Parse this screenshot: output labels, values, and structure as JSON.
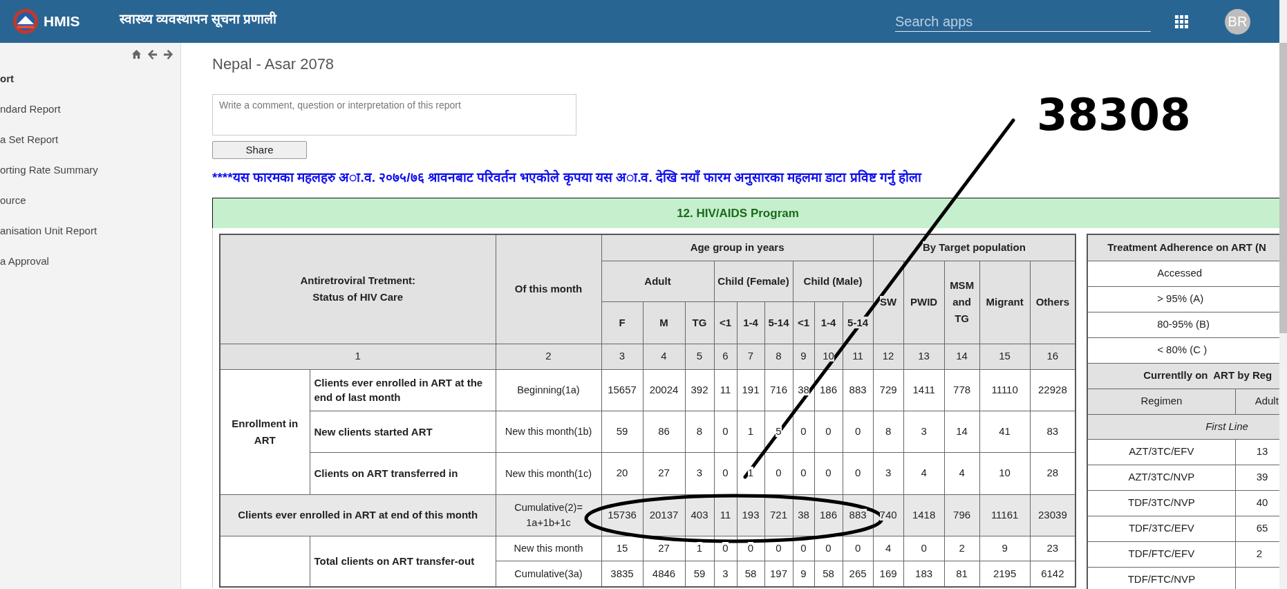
{
  "header": {
    "logo_text": "HMIS",
    "app_title": "स्वास्थ्य व्यवस्थापन सूचना प्रणाली",
    "search": {
      "placeholder": "Search apps"
    },
    "avatar": "BR"
  },
  "sidebar": {
    "items": [
      {
        "label": "ort",
        "kind": "heading"
      },
      {
        "label": "ndard Report",
        "kind": "link"
      },
      {
        "label": "a Set Report",
        "kind": "link"
      },
      {
        "label": "orting Rate Summary",
        "kind": "link"
      },
      {
        "label": "ource",
        "kind": "link"
      },
      {
        "label": "anisation Unit Report",
        "kind": "link"
      },
      {
        "label": "a Approval",
        "kind": "link"
      }
    ]
  },
  "page_title": "Nepal - Asar 2078",
  "comment": {
    "placeholder": "Write a comment, question or interpretation of this report"
  },
  "share_button": "Share",
  "notice": "****यस फारमका महलहरु अ◌ा.व. २०७५/७६ श्रावनबाट परिवर्तन भएकोले कृपया यस अ◌ा.व. देखि नयाँ फारम अनुसारका महलमा डाटा प्रविष्ट गर्नु होला",
  "section_title": "12. HIV/AIDS Program",
  "art_table": {
    "header_rows": [
      {
        "kind": "heading",
        "cells": [
          {
            "text": "Antiretroviral Tretment:\nStatus of HIV Care",
            "colspan": 2,
            "rowspan": 3
          },
          {
            "text": "Of this month",
            "rowspan": 3
          },
          {
            "text": "Age group in years",
            "colspan": 9
          },
          {
            "text": "By Target population",
            "colspan": 5
          }
        ]
      },
      {
        "kind": "heading",
        "cells": [
          {
            "text": "Adult",
            "colspan": 3
          },
          {
            "text": "Child (Female)",
            "colspan": 3
          },
          {
            "text": "Child (Male)",
            "colspan": 3
          },
          {
            "text": "SW",
            "rowspan": 2
          },
          {
            "text": "PWID",
            "rowspan": 2
          },
          {
            "text": "MSM and TG",
            "rowspan": 2
          },
          {
            "text": "Migrant",
            "rowspan": 2
          },
          {
            "text": "Others",
            "rowspan": 2
          }
        ]
      },
      {
        "kind": "heading",
        "cells": [
          {
            "text": "F"
          },
          {
            "text": "M"
          },
          {
            "text": "TG"
          },
          {
            "text": "<1"
          },
          {
            "text": "1-4"
          },
          {
            "text": "5-14"
          },
          {
            "text": "<1"
          },
          {
            "text": "1-4"
          },
          {
            "text": "5-14"
          }
        ]
      },
      {
        "kind": "index",
        "cells": [
          {
            "text": "1",
            "colspan": 2
          },
          {
            "text": "2"
          },
          {
            "text": "3"
          },
          {
            "text": "4"
          },
          {
            "text": "5"
          },
          {
            "text": "6"
          },
          {
            "text": "7"
          },
          {
            "text": "8"
          },
          {
            "text": "9"
          },
          {
            "text": "10"
          },
          {
            "text": "11"
          },
          {
            "text": "12"
          },
          {
            "text": "13"
          },
          {
            "text": "14"
          },
          {
            "text": "15"
          },
          {
            "text": "16"
          }
        ]
      }
    ],
    "rows": [
      {
        "kind": "data",
        "cells": [
          {
            "kind": "group",
            "text": "Enrollment in ART",
            "rowspan": 3
          },
          {
            "kind": "label",
            "text": "Clients ever enrolled in ART at the end of last month"
          },
          {
            "kind": "period",
            "text": "Beginning(1a)"
          }
        ],
        "values": [
          "15657",
          "20024",
          "392",
          "11",
          "191",
          "716",
          "38",
          "186",
          "883",
          "729",
          "1411",
          "778",
          "11110",
          "22928"
        ]
      },
      {
        "kind": "data",
        "cells": [
          {
            "kind": "label",
            "text": "New clients started ART"
          },
          {
            "kind": "period",
            "text": "New this month(1b)"
          }
        ],
        "values": [
          "59",
          "86",
          "8",
          "0",
          "1",
          "5",
          "0",
          "0",
          "0",
          "8",
          "3",
          "14",
          "41",
          "83"
        ]
      },
      {
        "kind": "data",
        "cells": [
          {
            "kind": "label",
            "text": "Clients on ART transferred in"
          },
          {
            "kind": "period",
            "text": "New this month(1c)"
          }
        ],
        "values": [
          "20",
          "27",
          "3",
          "0",
          "1",
          "0",
          "0",
          "0",
          "0",
          "3",
          "4",
          "4",
          "10",
          "28"
        ]
      },
      {
        "kind": "total",
        "cells": [
          {
            "kind": "group",
            "text": "Clients ever enrolled in ART at end of this month",
            "colspan": 2
          },
          {
            "kind": "period",
            "text": "Cumulative(2)=\n1a+1b+1c"
          }
        ],
        "values": [
          "15736",
          "20137",
          "403",
          "11",
          "193",
          "721",
          "38",
          "186",
          "883",
          "740",
          "1418",
          "796",
          "11161",
          "23039"
        ]
      },
      {
        "kind": "data",
        "cells": [
          {
            "kind": "group",
            "rowspan": 2
          },
          {
            "kind": "label",
            "text": "Total clients on ART transfer-out",
            "rowspan": 2
          },
          {
            "kind": "period",
            "text": "New this month"
          }
        ],
        "values": [
          "15",
          "27",
          "1",
          "0",
          "0",
          "0",
          "0",
          "0",
          "0",
          "4",
          "0",
          "2",
          "9",
          "23"
        ]
      },
      {
        "kind": "data",
        "cells": [
          {
            "kind": "period",
            "text": "Cumulative(3a)"
          }
        ],
        "values": [
          "3835",
          "4846",
          "59",
          "3",
          "58",
          "197",
          "9",
          "58",
          "265",
          "169",
          "183",
          "81",
          "2195",
          "6142"
        ]
      }
    ]
  },
  "adherence_table": {
    "title": "Treatment Adherence on ART (N",
    "levels": [
      "Accessed",
      "> 95% (A)",
      "80-95% (B)",
      "< 80% (C )"
    ],
    "regimen_title": "Currentlly on  ART by Reg",
    "columns": [
      "Regimen",
      "Adult"
    ],
    "group_label": "First Line",
    "rows": [
      {
        "regimen": "AZT/3TC/EFV",
        "adult": "13"
      },
      {
        "regimen": "AZT/3TC/NVP",
        "adult": "39"
      },
      {
        "regimen": "TDF/3TC/NVP",
        "adult": "40"
      },
      {
        "regimen": "TDF/3TC/EFV",
        "adult": "65"
      },
      {
        "regimen": "TDF/FTC/EFV",
        "adult": "2"
      },
      {
        "regimen": "TDF/FTC/NVP"
      }
    ]
  },
  "annotation": {
    "text": "38308"
  }
}
